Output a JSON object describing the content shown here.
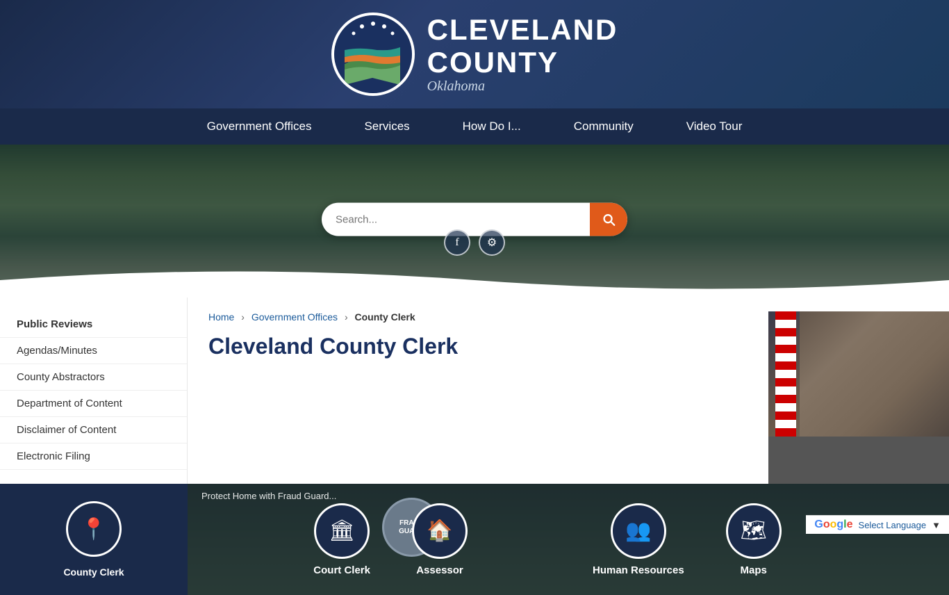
{
  "site": {
    "title_line1": "CLEVELAND",
    "title_line2": "COUNTY",
    "state": "Oklahoma"
  },
  "nav": {
    "items": [
      {
        "label": "Government Offices",
        "href": "#"
      },
      {
        "label": "Services",
        "href": "#"
      },
      {
        "label": "How Do I...",
        "href": "#"
      },
      {
        "label": "Community",
        "href": "#"
      },
      {
        "label": "Video Tour",
        "href": "#"
      }
    ]
  },
  "search": {
    "placeholder": "Search..."
  },
  "breadcrumb": {
    "home": "Home",
    "gov_offices": "Government Offices",
    "current": "County Clerk"
  },
  "page": {
    "title": "Cleveland County Clerk"
  },
  "sidebar": {
    "items": [
      {
        "label": "Public Reviews"
      },
      {
        "label": "Agendas/Minutes"
      },
      {
        "label": "County Abstractors"
      },
      {
        "label": "Department of Content"
      },
      {
        "label": "Disclaimer of Content"
      },
      {
        "label": "Electronic Filing"
      }
    ],
    "county_clerk_label": "County Clerk"
  },
  "quick_icons": [
    {
      "label": "Court Clerk",
      "icon": "🏛️"
    },
    {
      "label": "Assessor",
      "icon": "🏠"
    },
    {
      "label": "Human Resources",
      "icon": "👥"
    },
    {
      "label": "Maps",
      "icon": "🗺️"
    }
  ],
  "translate": {
    "label": "Select Language"
  },
  "social": {
    "facebook_label": "Facebook",
    "settings_label": "Settings"
  }
}
